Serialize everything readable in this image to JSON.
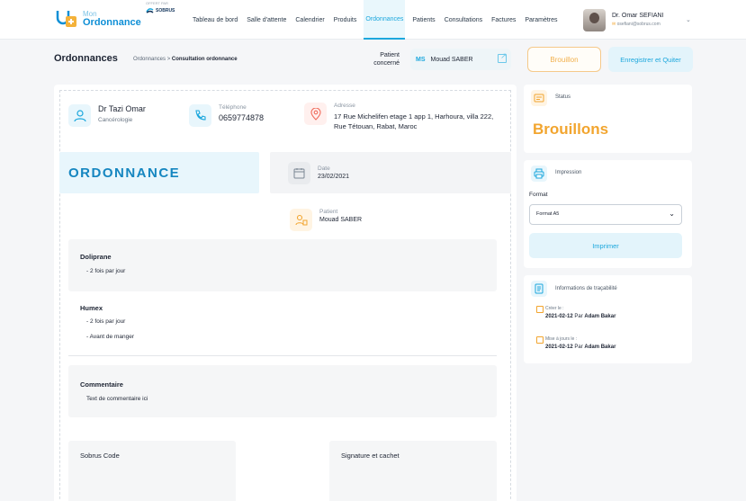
{
  "app": {
    "logo_top": "Mon",
    "logo_main": "Ordonnance",
    "logo_sub": "OFFERT PAR",
    "partner": "SOBRUS"
  },
  "nav": {
    "items": [
      {
        "label": "Tableau de bord"
      },
      {
        "label": "Salle d'attente"
      },
      {
        "label": "Calendrier"
      },
      {
        "label": "Produits"
      },
      {
        "label": "Ordonnances"
      },
      {
        "label": "Patients"
      },
      {
        "label": "Consultations"
      },
      {
        "label": "Factures"
      },
      {
        "label": "Paramètres"
      }
    ],
    "active": "Ordonnances"
  },
  "user": {
    "name": "Dr. Omar SEFIANI",
    "email": "osefiani@sobrus.com"
  },
  "subheader": {
    "title": "Ordonnances",
    "breadcrumb_parent": "Ordonnances",
    "breadcrumb_sep": ">",
    "breadcrumb_current": "Consultation ordonnance",
    "patient_label": "Patient concerné",
    "patient_initials": "MS",
    "patient_name": "Mouad SABER",
    "draft_button": "Brouillon",
    "save_button": "Enregistrer et Quiter"
  },
  "document": {
    "doctor_name": "Dr Tazi Omar",
    "doctor_specialty": "Cancérologie",
    "phone_label": "Téléphone",
    "phone": "0659774878",
    "address_label": "Adresse",
    "address": "17 Rue Michelifen etage 1 app 1, Harhoura, villa 222, Rue Tétouan, Rabat, Maroc",
    "title": "ORDONNANCE",
    "date_label": "Date",
    "date": "23/02/2021",
    "patient_label": "Patient",
    "patient_name": "Mouad SABER",
    "medications": [
      {
        "name": "Doliprane",
        "lines": [
          "- 2 fois par jour"
        ]
      },
      {
        "name": "Humex",
        "lines": [
          "- 2 fois par jour",
          "- Avant de manger"
        ]
      }
    ],
    "comment_title": "Commentaire",
    "comment_text": "Text de commentaire ici",
    "code_title": "Sobrus Code",
    "signature_title": "Signature et cachet"
  },
  "sidebar": {
    "status_label": "Status",
    "status_value": "Brouillons",
    "print_label": "Impression",
    "format_label": "Format",
    "format_value": "Format A5",
    "print_button": "Imprimer",
    "trace_label": "Informations de traçabilité",
    "created_label": "Créer le :",
    "created_value": "2021-02-12",
    "created_by_prefix": "Par",
    "created_by": "Adam Bakar",
    "updated_label": "Mise à jours le :",
    "updated_value": "2021-02-12",
    "updated_by_prefix": "Par",
    "updated_by": "Adam Bakar"
  },
  "colors": {
    "accent": "#1ba7dd",
    "warning": "#f2a52f",
    "banner": "#e8f6fc"
  }
}
